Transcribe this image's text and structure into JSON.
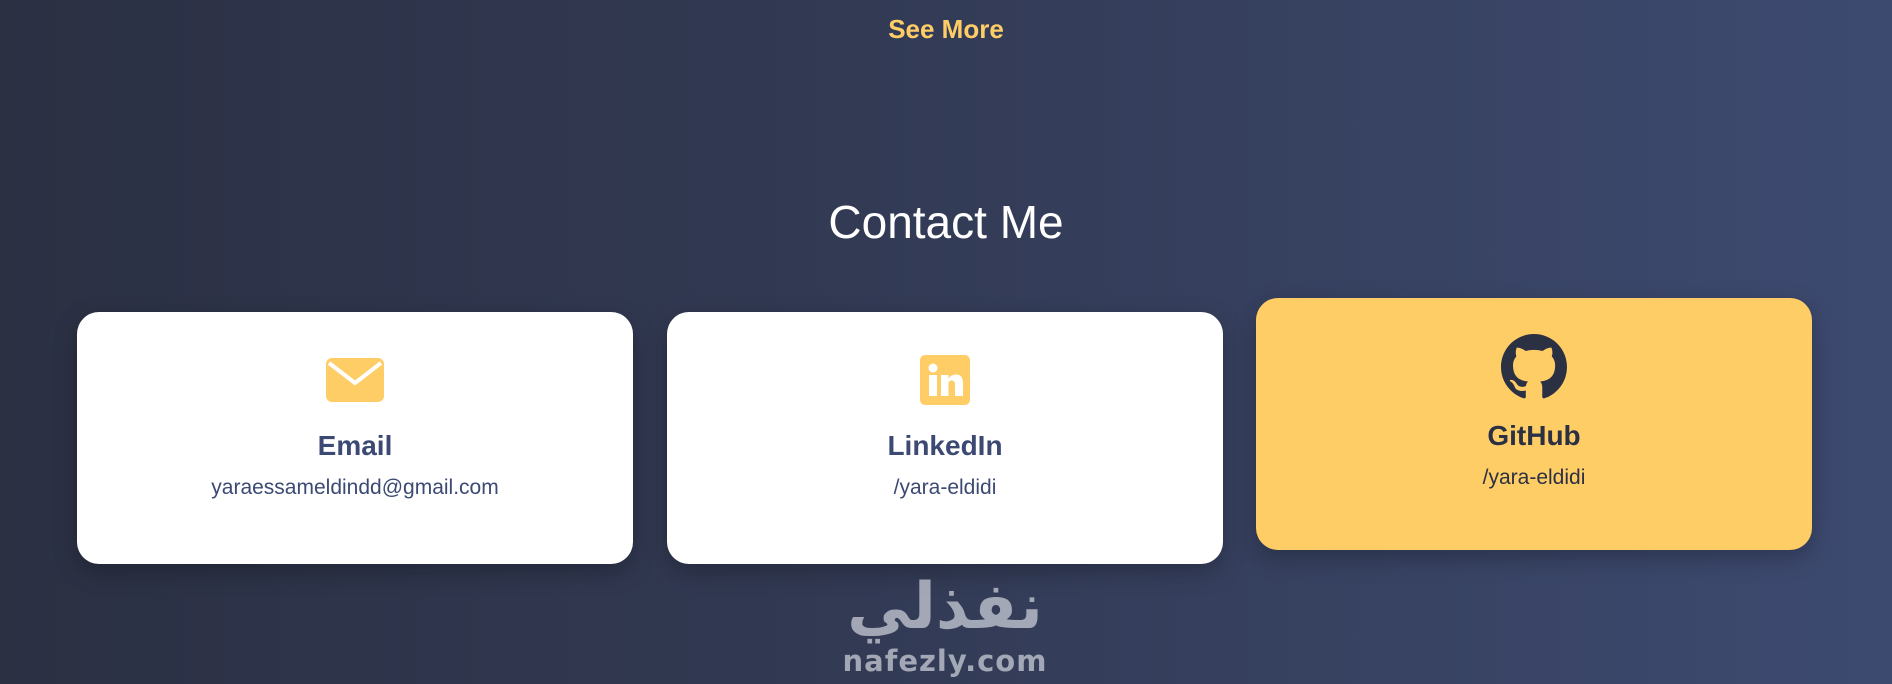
{
  "links": {
    "see_more_label": "See More"
  },
  "contact": {
    "title": "Contact Me",
    "cards": [
      {
        "icon": "envelope-icon",
        "label": "Email",
        "value": "yaraessameldindd@gmail.com"
      },
      {
        "icon": "linkedin-icon",
        "label": "LinkedIn",
        "value": "/yara-eldidi"
      },
      {
        "icon": "github-icon",
        "label": "GitHub",
        "value": "/yara-eldidi"
      }
    ]
  },
  "watermark": {
    "arabic": "نفذلي",
    "latin": "nafezly.com"
  },
  "colors": {
    "accent": "#ffcd66",
    "card_text": "#3c4a73",
    "card_bg": "#ffffff",
    "dark_text": "#2b3043"
  }
}
